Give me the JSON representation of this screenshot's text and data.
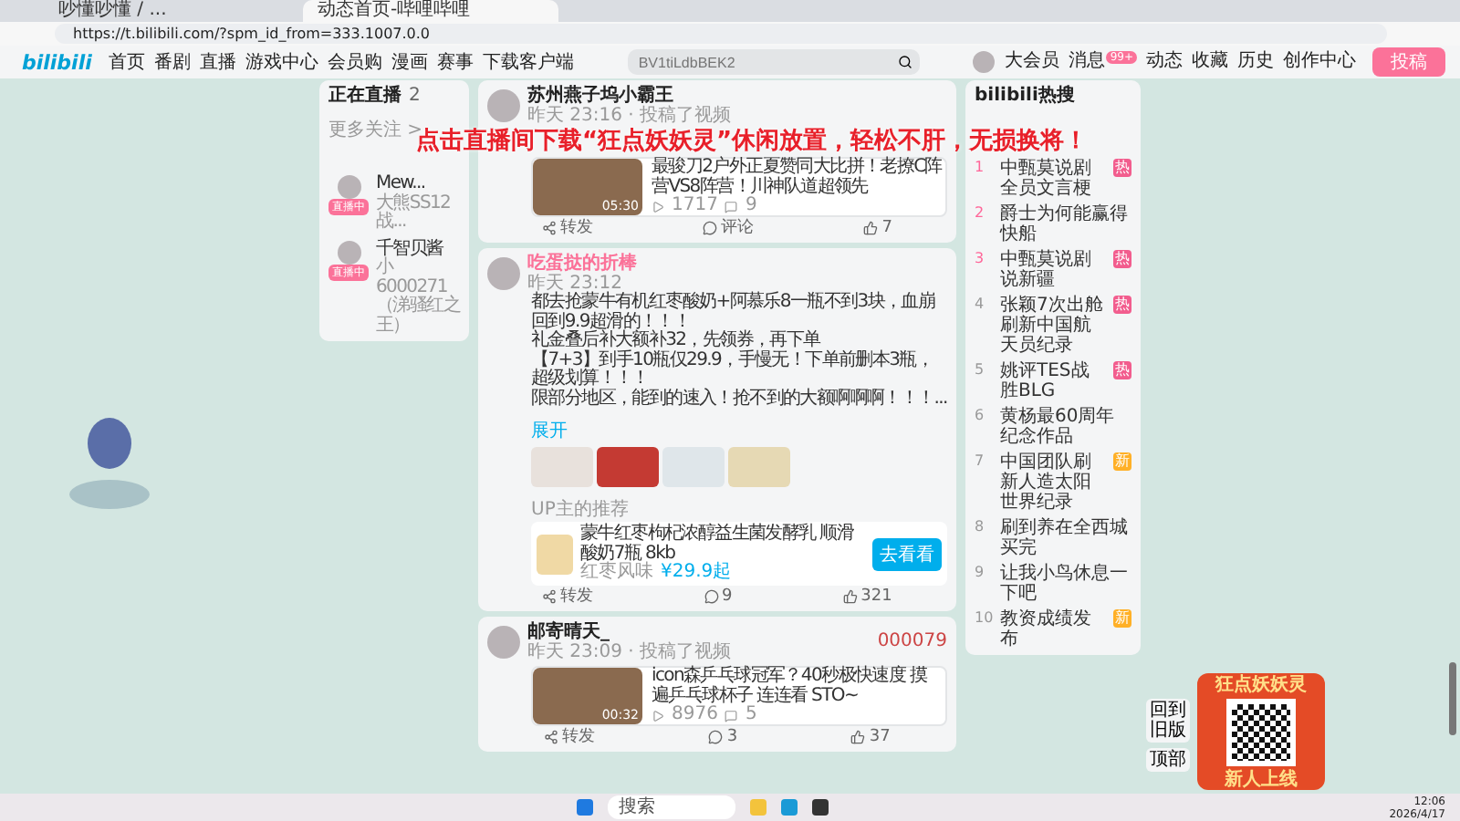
{
  "browser": {
    "tabs": [
      {
        "title": "吵懂吵懂 / ...",
        "selected": false
      },
      {
        "title": "动态首页-哔哩哔哩",
        "selected": true
      }
    ],
    "url": "https://t.bilibili.com/?spm_id_from=333.1007.0.0"
  },
  "nav": {
    "logo": "bilibili",
    "links": [
      "首页",
      "番剧",
      "直播",
      "游戏中心",
      "会员购",
      "漫画",
      "赛事",
      "下载客户端"
    ],
    "search": {
      "placeholder": "BV1tiLdbBEK2"
    },
    "actions": [
      {
        "label": "大会员"
      },
      {
        "label": "消息",
        "badge": "99+"
      },
      {
        "label": "动态"
      },
      {
        "label": "收藏"
      },
      {
        "label": "历史"
      },
      {
        "label": "创作中心"
      }
    ],
    "upload": "投稿"
  },
  "live": {
    "title": "正在直播",
    "count": "2",
    "more": "更多关注 >",
    "items": [
      {
        "name": "Mew...",
        "desc": "大熊SS12战...",
        "badge": "直播中"
      },
      {
        "name": "千智贝酱",
        "desc": "小6000271（涕骚红之王）",
        "badge": "直播中"
      }
    ]
  },
  "banner": "点击直播间下载“狂点妖妖灵”休闲放置，轻松不肝，无损换将！",
  "posts": [
    {
      "kind": "video",
      "author": "苏州燕子坞小霸王",
      "vip": false,
      "meta": "昨天 23:16 · 投稿了视频",
      "video": {
        "title": "最骏刀2户外正夏赞同大比拼！老撩C阵营VS8阵营！川神队道超领先",
        "duration": "05:30",
        "views": "1717",
        "danmaku": "9"
      },
      "share": "转发",
      "comment": "评论",
      "like": "7"
    },
    {
      "kind": "text",
      "author": "吃蛋挞的折棒",
      "vip": true,
      "meta": "昨天 23:12",
      "paragraphs": [
        "都去抢蒙牛有机红枣酸奶+阿慕乐8一瓶不到3块，血崩回到9.9超滑的！！！",
        "礼金叠后补大额补32，先领券，再下单",
        "【7+3】到手10瓶仅29.9，手慢无！下单前删本3瓶，超级划算！！！",
        "限部分地区，能到的速入！抢不到的大额啊啊啊！！！..."
      ],
      "expand": "展开",
      "goods": {
        "label": "UP主的推荐",
        "title": "蒙牛红枣枸杞浓醇益生菌发酵乳 顺滑酸奶7瓶 8kb",
        "shop": "红枣风味",
        "price": "¥29.9起",
        "button": "去看看"
      },
      "share": "转发",
      "comment": "9",
      "like": "321"
    },
    {
      "kind": "video",
      "author": "邮寄晴天_",
      "vip": false,
      "meta": "昨天 23:09 · 投稿了视频",
      "tag": "000079",
      "video": {
        "title": "icon森乒乓球冠军？40秒极快速度 摸遍乒乓球杯子 连连看 STO~",
        "duration": "00:32",
        "views": "8976",
        "danmaku": "5"
      },
      "share": "转发",
      "comment": "3",
      "like": "37"
    }
  ],
  "hot": {
    "title": "bilibili热搜",
    "items": [
      {
        "rank": "1",
        "text": "中甄莫说剧全员文言梗",
        "tag": {
          "kind": "hot",
          "label": "热"
        }
      },
      {
        "rank": "2",
        "text": "爵士为何能赢得快船"
      },
      {
        "rank": "3",
        "text": "中甄莫说剧说新疆",
        "tag": {
          "kind": "hot",
          "label": "热"
        }
      },
      {
        "rank": "4",
        "text": "张颖7次出舱刷新中国航天员纪录",
        "tag": {
          "kind": "hot",
          "label": "热"
        }
      },
      {
        "rank": "5",
        "text": "姚评TES战胜BLG",
        "tag": {
          "kind": "hot",
          "label": "热"
        }
      },
      {
        "rank": "6",
        "text": "黄杨最60周年纪念作品"
      },
      {
        "rank": "7",
        "text": "中国团队刷新人造太阳世界纪录",
        "tag": {
          "kind": "new",
          "label": "新"
        }
      },
      {
        "rank": "8",
        "text": "刷到养在全西城买完"
      },
      {
        "rank": "9",
        "text": "让我小鸟休息一下吧"
      },
      {
        "rank": "10",
        "text": "教资成绩发布",
        "tag": {
          "kind": "new",
          "label": "新"
        }
      }
    ]
  },
  "side_buttons": [
    "回到旧版",
    "顶部"
  ],
  "ad": {
    "title": "狂点妖妖灵",
    "caption": "新人上线"
  },
  "taskbar": {
    "search": "搜索",
    "time": "12:06",
    "date": "2026/4/17"
  }
}
